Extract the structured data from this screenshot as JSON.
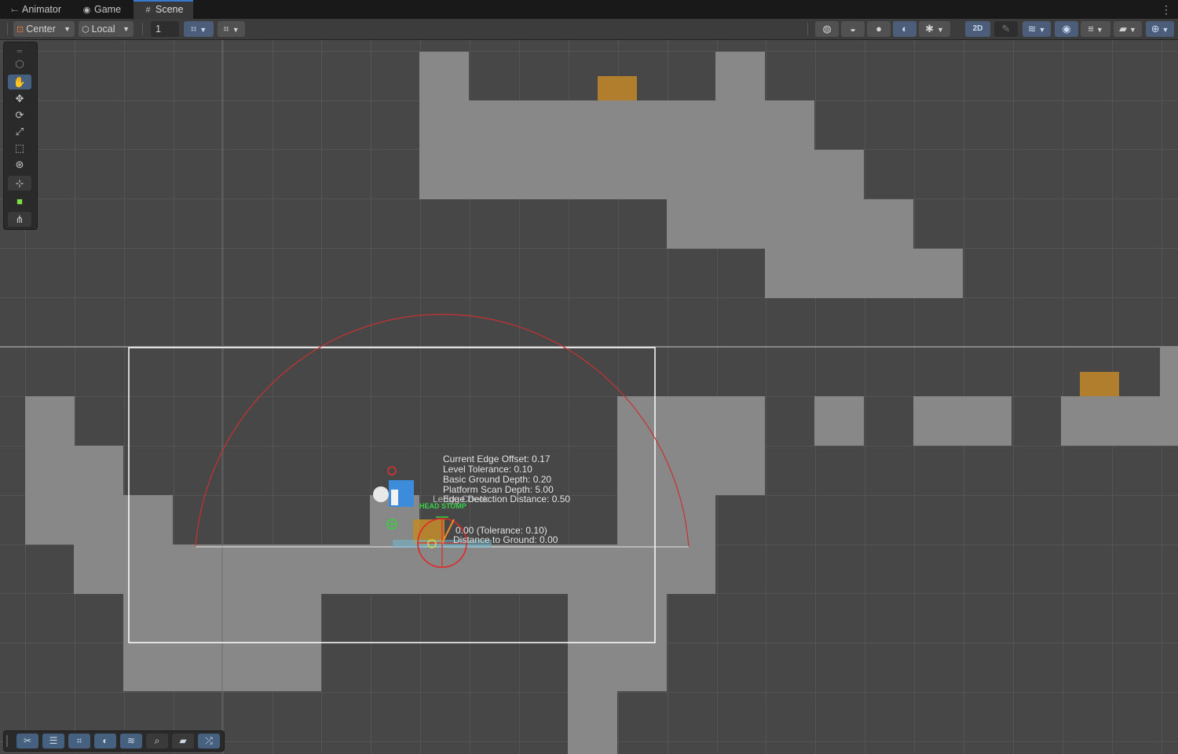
{
  "tabs": {
    "animator": {
      "label": "Animator",
      "icon": "animator-icon"
    },
    "game": {
      "label": "Game",
      "icon": "gamepad-icon"
    },
    "scene": {
      "label": "Scene",
      "icon": "hash-icon"
    }
  },
  "toolbar": {
    "pivot_mode": "Center",
    "pivot_rotation": "Local",
    "grid_size": "1",
    "mode_2d": "2D"
  },
  "debug_labels": {
    "current_edge_offset": "Current Edge Offset: 0.17",
    "level_tolerance": "Level Tolerance: 0.10",
    "basic_ground_depth": "Basic Ground Depth: 0.20",
    "platform_scan_depth": "Platform Scan Depth: 5.00",
    "ledge_detection_distance": "Edge Detection Distance: 0.50",
    "ledge_check": "Ledge Check",
    "head_stomp": "HEAD STOMP",
    "tolerance": "0.00 (Tolerance: 0.10)",
    "ground_distance": "Distance to Ground: 0.00"
  },
  "colors": {
    "background": "#474747",
    "platform": "#888888",
    "camera_frame": "#ffffff",
    "detection_arc": "#c83232",
    "enemy_box": "#b07e2c",
    "accent_blue": "#3a79d0"
  }
}
